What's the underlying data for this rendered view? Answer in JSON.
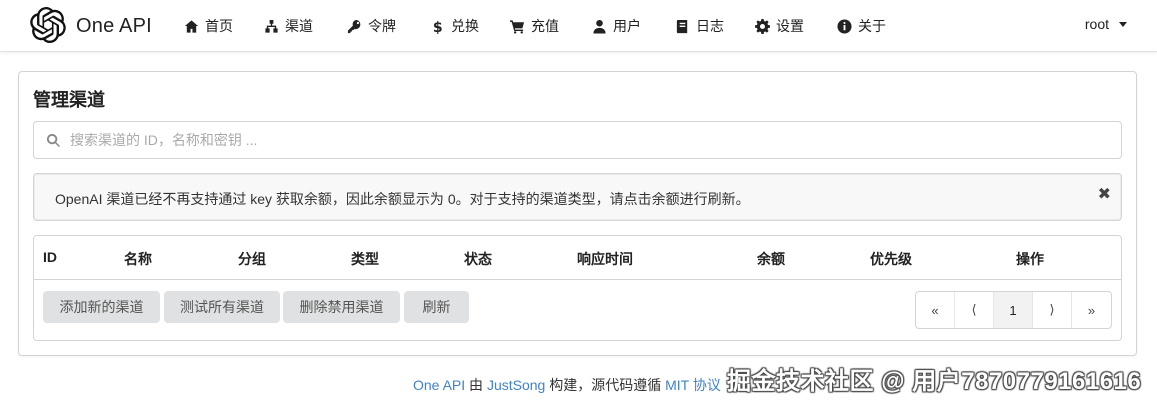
{
  "app": {
    "brand": "One API"
  },
  "nav": {
    "items": [
      {
        "label": "首页",
        "icon": "home-icon"
      },
      {
        "label": "渠道",
        "icon": "sitemap-icon"
      },
      {
        "label": "令牌",
        "icon": "key-icon"
      },
      {
        "label": "兑换",
        "icon": "dollar-icon"
      },
      {
        "label": "充值",
        "icon": "cart-icon"
      },
      {
        "label": "用户",
        "icon": "user-icon"
      },
      {
        "label": "日志",
        "icon": "book-icon"
      },
      {
        "label": "设置",
        "icon": "gear-icon"
      },
      {
        "label": "关于",
        "icon": "info-icon"
      }
    ],
    "user": "root"
  },
  "page": {
    "title": "管理渠道",
    "search_placeholder": "搜索渠道的 ID，名称和密钥 ...",
    "message": "OpenAI 渠道已经不再支持通过 key 获取余额，因此余额显示为 0。对于支持的渠道类型，请点击余额进行刷新。",
    "close_symbol": "✖"
  },
  "table": {
    "columns": [
      "ID",
      "名称",
      "分组",
      "类型",
      "状态",
      "响应时间",
      "余额",
      "优先级",
      "操作"
    ],
    "rows": []
  },
  "actions": {
    "add": "添加新的渠道",
    "test_all": "测试所有渠道",
    "delete_disabled": "删除禁用渠道",
    "refresh": "刷新"
  },
  "pagination": {
    "first": "«",
    "prev": "⟨",
    "current": "1",
    "next": "⟩",
    "last": "»"
  },
  "footer": {
    "name": "One API",
    "by": "由",
    "author": "JustSong",
    "built": "构建，源代码遵循",
    "license": "MIT",
    "agreement": "协议"
  },
  "watermark": "掘金技术社区 @ 用户7870779161616",
  "colors": {
    "link": "#4183c4",
    "button_bg": "#e0e1e2",
    "message_bg": "#f8f8f9"
  }
}
